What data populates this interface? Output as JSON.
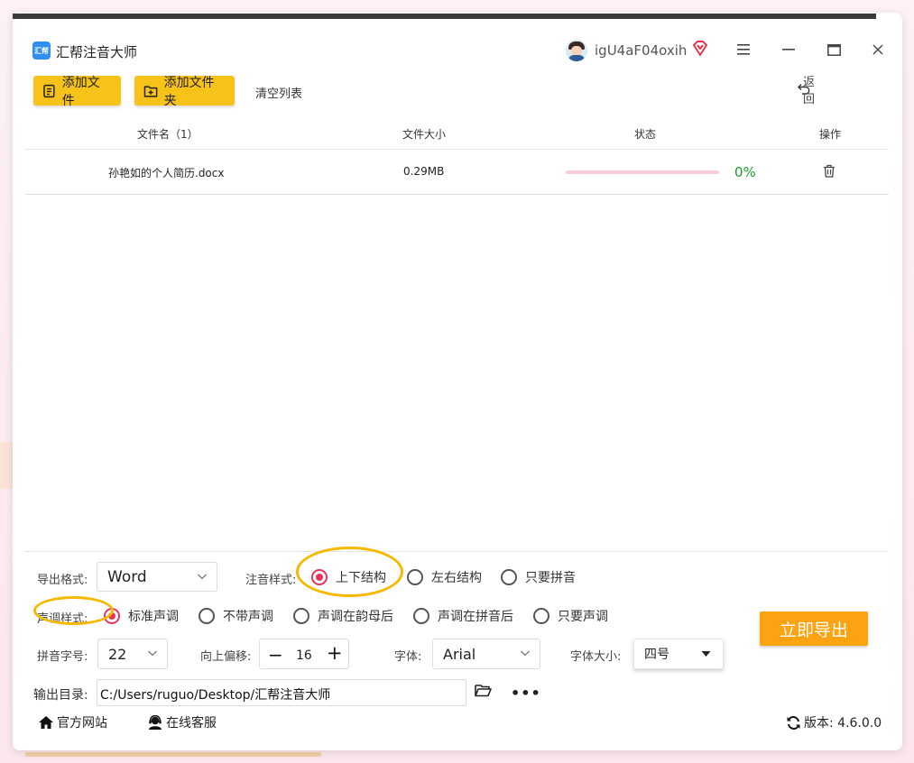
{
  "app": {
    "title": "汇帮注音大师",
    "logo_text": "汇帮"
  },
  "user": {
    "name": "igU4aF04oxih"
  },
  "window_controls": {
    "menu": "≡",
    "minimize": "—",
    "maximize": "□",
    "close": "✕"
  },
  "toolbar": {
    "add_file_label": "添加文件",
    "add_folder_label": "添加文件夹",
    "clear_list_label": "清空列表",
    "back_label": "返回"
  },
  "table": {
    "headers": {
      "file_name": "文件名（1）",
      "file_size": "文件大小",
      "status": "状态",
      "action": "操作"
    },
    "rows": [
      {
        "file_name": "孙艳如的个人简历.docx",
        "file_size": "0.29MB",
        "progress": 0,
        "progress_text": "0%"
      }
    ]
  },
  "settings": {
    "export_format": {
      "label": "导出格式:",
      "value": "Word"
    },
    "annotation_style": {
      "label": "注音样式:",
      "options": [
        "上下结构",
        "左右结构",
        "只要拼音"
      ],
      "selected": "上下结构"
    },
    "tone_style": {
      "label": "声调样式:",
      "options": [
        "标准声调",
        "不带声调",
        "声调在韵母后",
        "声调在拼音后",
        "只要声调"
      ],
      "selected": "标准声调"
    },
    "pinyin_size": {
      "label": "拼音字号:",
      "value": "22"
    },
    "offset": {
      "label": "向上偏移:",
      "value": "16",
      "minus": "−",
      "plus": "+"
    },
    "font": {
      "label": "字体:",
      "value": "Arial"
    },
    "font_size": {
      "label": "字体大小:",
      "value": "四号"
    },
    "output_dir": {
      "label": "输出目录:",
      "value": "C:/Users/ruguo/Desktop/汇帮注音大师",
      "more": "•••"
    }
  },
  "export_button": {
    "label": "立即导出"
  },
  "footer": {
    "website": "官方网站",
    "support": "在线客服",
    "version_label": "版本: 4.6.0.0"
  },
  "colors": {
    "accent_yellow": "#f7c21a",
    "export_orange": "#fda211",
    "radio_active": "#e8345a",
    "progress_green": "#1a9a2a",
    "highlight": "#f5b900"
  }
}
